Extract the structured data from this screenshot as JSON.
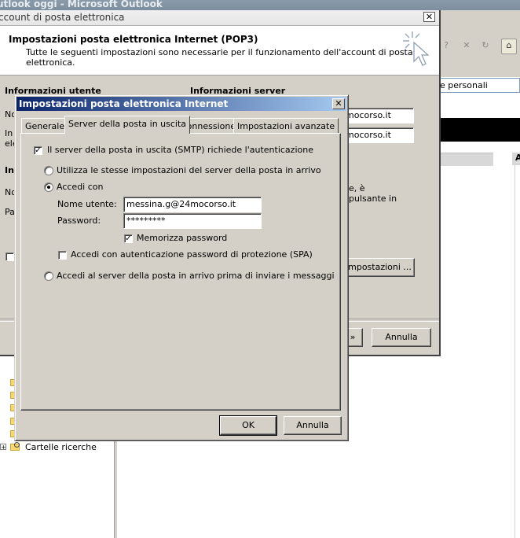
{
  "outlook": {
    "window_title": "utlook oggi - Microsoft Outlook",
    "search_field_text": "e personali",
    "right_header_letter": "A",
    "tree_item_label": "Cartelle ricerche",
    "tree_expand_symbol": "+"
  },
  "account_dialog": {
    "title": "ccount di posta elettronica",
    "header_title": "Impostazioni posta elettronica Internet (POP3)",
    "header_description_line1": "Tutte le seguenti impostazioni sono necessarie per il funzionamento dell'account di posta",
    "header_description_line2": "elettronica.",
    "section_user": "Informazioni utente",
    "section_server": "Informazioni server",
    "label_no": "No",
    "label_in": "In",
    "label_ele": "ele",
    "label_in2": "In",
    "label_no2": "No",
    "label_pa": "Pa",
    "server_incoming_value": "mocorso.it",
    "server_outgoing_value": "mocorso.it",
    "side_text_line1": "e, è",
    "side_text_line2": "pulsante in",
    "side_text_line3": "",
    "more_settings_button": "impostazioni ...",
    "next_button_fragment": "»",
    "cancel_button": "Annulla"
  },
  "settings_dialog": {
    "title": "Impostazioni posta elettronica Internet",
    "tabs": [
      {
        "label": "Generale",
        "active": false
      },
      {
        "label": "Server della posta in uscita",
        "active": true
      },
      {
        "label": "Connessione",
        "active": false
      },
      {
        "label": "Impostazioni avanzate",
        "active": false
      }
    ],
    "smtp_auth_checkbox": {
      "label": "Il server della posta in uscita (SMTP) richiede l'autenticazione",
      "checked": true
    },
    "radio_same_settings": {
      "label": "Utilizza le stesse impostazioni del server della posta in arrivo",
      "selected": false
    },
    "radio_login_with": {
      "label": "Accedi con",
      "selected": true
    },
    "username_label": "Nome utente:",
    "username_value": "messina.g@24mocorso.it",
    "password_label": "Password:",
    "password_value": "*********",
    "remember_password": {
      "label": "Memorizza password",
      "checked": true
    },
    "spa_checkbox": {
      "label": "Accedi con autenticazione password di protezione (SPA)",
      "checked": false
    },
    "radio_login_incoming_first": {
      "label": "Accedi al server della posta in arrivo prima di inviare i messaggi",
      "selected": false
    },
    "ok_button": "OK",
    "cancel_button": "Annulla"
  }
}
